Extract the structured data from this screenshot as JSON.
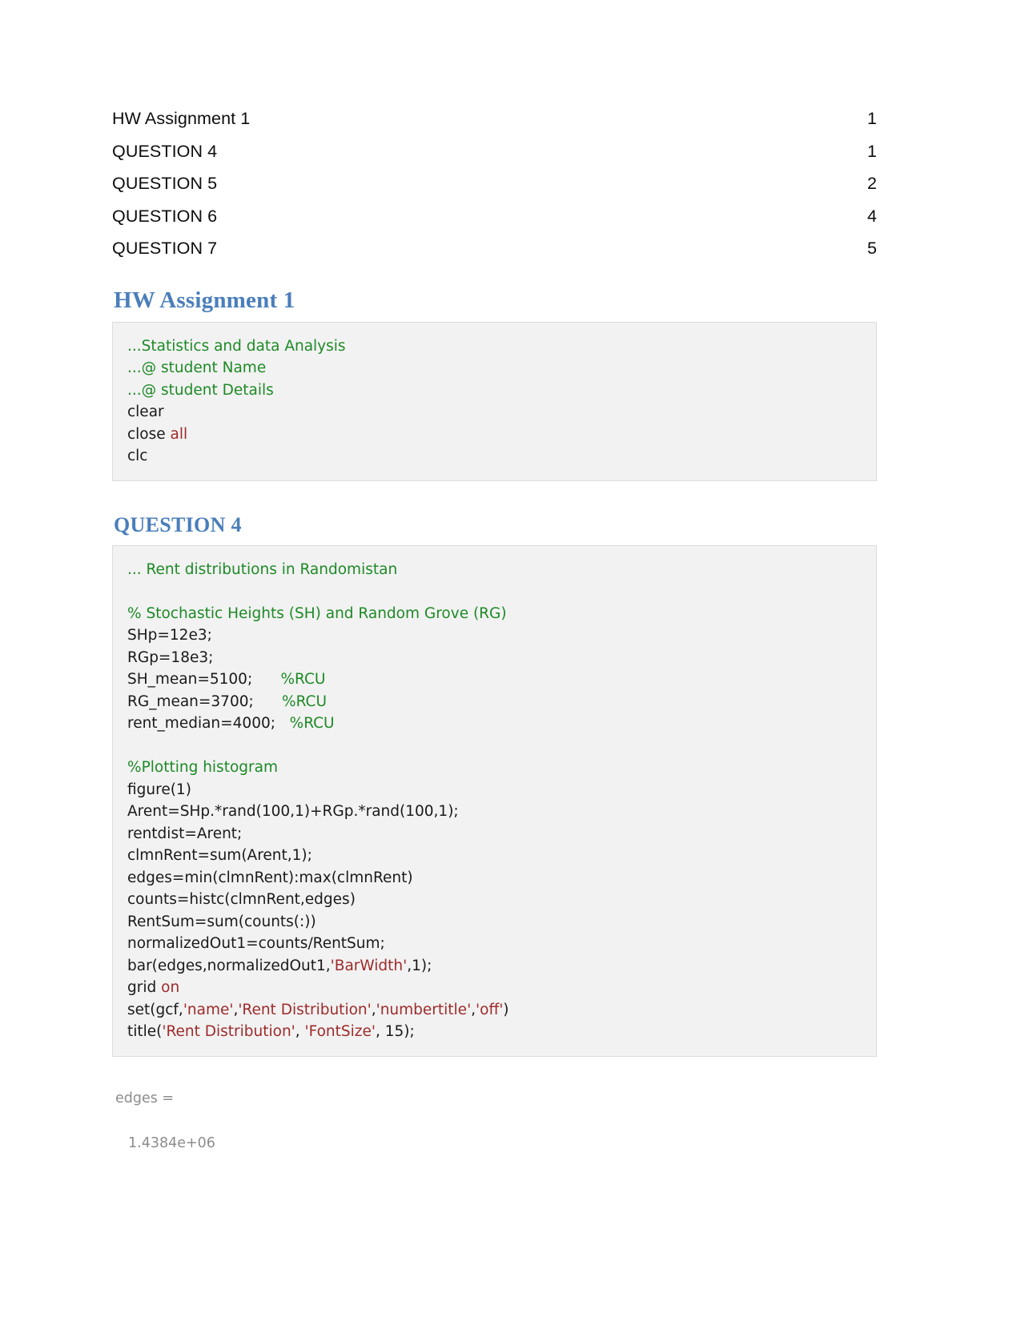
{
  "document": {
    "toc": {
      "entries": [
        {
          "label": "HW Assignment 1",
          "page": "1"
        },
        {
          "label": "QUESTION 4",
          "page": "1"
        },
        {
          "label": "QUESTION 5",
          "page": "2"
        },
        {
          "label": "QUESTION 6",
          "page": "4"
        },
        {
          "label": "QUESTION 7",
          "page": "5"
        }
      ]
    },
    "sections": [
      {
        "heading": "HW Assignment 1",
        "code": [
          {
            "segments": [
              {
                "text": "...Statistics and data Analysis",
                "style": "cmt"
              }
            ]
          },
          {
            "segments": [
              {
                "text": "...@ student Name",
                "style": "cmt"
              }
            ]
          },
          {
            "segments": [
              {
                "text": "...@ student Details",
                "style": "cmt"
              }
            ]
          },
          {
            "segments": [
              {
                "text": "clear",
                "style": "plain"
              }
            ]
          },
          {
            "segments": [
              {
                "text": "close ",
                "style": "plain"
              },
              {
                "text": "all",
                "style": "kw"
              }
            ]
          },
          {
            "segments": [
              {
                "text": "clc",
                "style": "plain"
              }
            ]
          }
        ]
      },
      {
        "heading": "QUESTION 4",
        "code": [
          {
            "segments": [
              {
                "text": "... Rent distributions in Randomistan",
                "style": "cmt"
              }
            ]
          },
          {
            "segments": [
              {
                "text": "",
                "style": "plain"
              }
            ]
          },
          {
            "segments": [
              {
                "text": "% Stochastic Heights (SH) and Random Grove (RG)",
                "style": "cmt"
              }
            ]
          },
          {
            "segments": [
              {
                "text": "SHp=12e3;",
                "style": "plain"
              }
            ]
          },
          {
            "segments": [
              {
                "text": "RGp=18e3;",
                "style": "plain"
              }
            ]
          },
          {
            "segments": [
              {
                "text": "SH_mean=5100;      ",
                "style": "plain"
              },
              {
                "text": "%RCU",
                "style": "cmt"
              }
            ]
          },
          {
            "segments": [
              {
                "text": "RG_mean=3700;      ",
                "style": "plain"
              },
              {
                "text": "%RCU",
                "style": "cmt"
              }
            ]
          },
          {
            "segments": [
              {
                "text": "rent_median=4000;   ",
                "style": "plain"
              },
              {
                "text": "%RCU",
                "style": "cmt"
              }
            ]
          },
          {
            "segments": [
              {
                "text": "",
                "style": "plain"
              }
            ]
          },
          {
            "segments": [
              {
                "text": "%Plotting histogram",
                "style": "cmt"
              }
            ]
          },
          {
            "segments": [
              {
                "text": "figure(1)",
                "style": "plain"
              }
            ]
          },
          {
            "segments": [
              {
                "text": "Arent=SHp.*rand(100,1)+RGp.*rand(100,1);",
                "style": "plain"
              }
            ]
          },
          {
            "segments": [
              {
                "text": "rentdist=Arent;",
                "style": "plain"
              }
            ]
          },
          {
            "segments": [
              {
                "text": "clmnRent=sum(Arent,1);",
                "style": "plain"
              }
            ]
          },
          {
            "segments": [
              {
                "text": "edges=min(clmnRent):max(clmnRent)",
                "style": "plain"
              }
            ]
          },
          {
            "segments": [
              {
                "text": "counts=histc(clmnRent,edges)",
                "style": "plain"
              }
            ]
          },
          {
            "segments": [
              {
                "text": "RentSum=sum(counts(:))",
                "style": "plain"
              }
            ]
          },
          {
            "segments": [
              {
                "text": "normalizedOut1=counts/RentSum;",
                "style": "plain"
              }
            ]
          },
          {
            "segments": [
              {
                "text": "bar(edges,normalizedOut1,",
                "style": "plain"
              },
              {
                "text": "'BarWidth'",
                "style": "str"
              },
              {
                "text": ",1);",
                "style": "plain"
              }
            ]
          },
          {
            "segments": [
              {
                "text": "grid ",
                "style": "plain"
              },
              {
                "text": "on",
                "style": "kw"
              }
            ]
          },
          {
            "segments": [
              {
                "text": "set(gcf,",
                "style": "plain"
              },
              {
                "text": "'name'",
                "style": "str"
              },
              {
                "text": ",",
                "style": "plain"
              },
              {
                "text": "'Rent Distribution'",
                "style": "str"
              },
              {
                "text": ",",
                "style": "plain"
              },
              {
                "text": "'numbertitle'",
                "style": "str"
              },
              {
                "text": ",",
                "style": "plain"
              },
              {
                "text": "'off'",
                "style": "str"
              },
              {
                "text": ")",
                "style": "plain"
              }
            ]
          },
          {
            "segments": [
              {
                "text": "title(",
                "style": "plain"
              },
              {
                "text": "'Rent Distribution'",
                "style": "str"
              },
              {
                "text": ", ",
                "style": "plain"
              },
              {
                "text": "'FontSize'",
                "style": "str"
              },
              {
                "text": ", 15);",
                "style": "plain"
              }
            ]
          }
        ],
        "output": [
          {
            "text": "edges =",
            "indent": false
          },
          {
            "text": "",
            "indent": false
          },
          {
            "text": "1.4384e+06",
            "indent": true
          }
        ]
      }
    ]
  }
}
